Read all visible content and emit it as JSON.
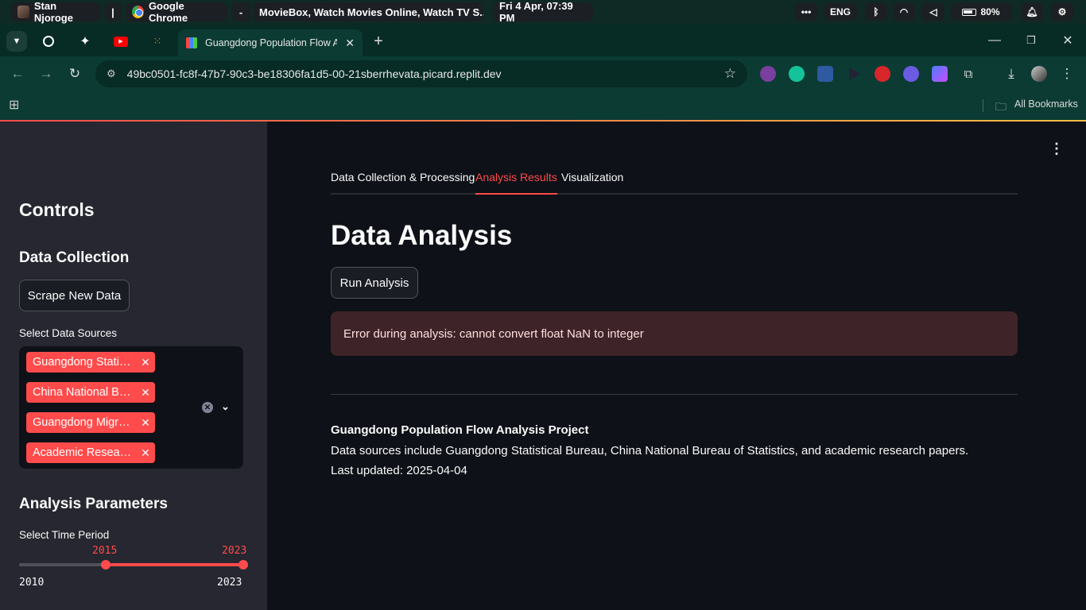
{
  "os": {
    "user": "Stan Njoroge",
    "separator": "|",
    "browser": "Google Chrome",
    "dash": "-",
    "window_title": "MovieBox, Watch Movies Online, Watch TV S...",
    "datetime": "Fri 4 Apr, 07:39 PM",
    "lang": "ENG",
    "battery": "80%"
  },
  "browser": {
    "active_tab_title": "Guangdong Population Flow Ar",
    "url": "49bc0501-fc8f-47b7-90c3-be18306fa1d5-00-21sberrhevata.picard.replit.dev",
    "bookmarks_label": "All Bookmarks"
  },
  "sidebar": {
    "title": "Controls",
    "data_collection": "Data Collection",
    "scrape_button": "Scrape New Data",
    "sources_label": "Select Data Sources",
    "sources": [
      "Guangdong Statistical Bureau",
      "China National Bureau of Statistics",
      "Guangdong Migration Survey",
      "Academic Research Papers"
    ],
    "analysis_params": "Analysis Parameters",
    "time_label": "Select Time Period",
    "slider": {
      "min": "2010",
      "max": "2023",
      "low": "2015",
      "high": "2023"
    }
  },
  "main": {
    "tabs": [
      "Data Collection & Processing",
      "Analysis Results",
      "Visualization"
    ],
    "active_tab": "Analysis Results",
    "title": "Data Analysis",
    "run_button": "Run Analysis",
    "error": "Error during analysis: cannot convert float NaN to integer",
    "footer_title": "Guangdong Population Flow Analysis Project",
    "footer_sources": "Data sources include Guangdong Statistical Bureau, China National Bureau of Statistics, and academic research papers.",
    "footer_updated": "Last updated: 2025-04-04"
  },
  "colors": {
    "accent": "#ff4b4b",
    "sidebar_bg": "#262730",
    "main_bg": "#0e1117",
    "error_bg": "#3e2428"
  }
}
